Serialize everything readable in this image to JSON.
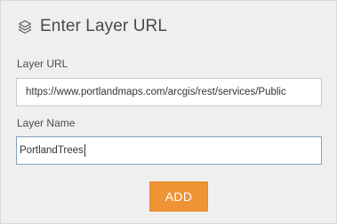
{
  "header": {
    "icon": "layers-icon",
    "title": "Enter Layer URL"
  },
  "form": {
    "url_label": "Layer URL",
    "url_value": "https://www.portlandmaps.com/arcgis/rest/services/Public",
    "name_label": "Layer Name",
    "name_value": "PortlandTrees"
  },
  "actions": {
    "add_label": "ADD"
  },
  "colors": {
    "panel_background": "#efefef",
    "accent": "#ef9434",
    "focused_border": "#8aa1bd"
  }
}
